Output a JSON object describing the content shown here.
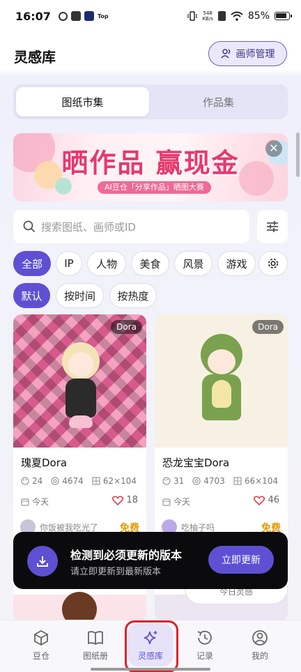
{
  "status_bar": {
    "time": "16:07",
    "top_label": "Top",
    "net_speed_value": "548",
    "net_speed_unit": "KB/s",
    "battery": "85%"
  },
  "header": {
    "title": "灵感库",
    "manage_button": "画师管理"
  },
  "tabs": [
    {
      "label": "图纸市集",
      "active": true
    },
    {
      "label": "作品集",
      "active": false
    }
  ],
  "banner": {
    "title": "晒作品 赢现金",
    "subtitle": "AI豆仓「分享作品」晒图大赛",
    "close_glyph": "✕"
  },
  "search": {
    "placeholder": "搜索图纸、画师或ID"
  },
  "categories": [
    "全部",
    "IP",
    "人物",
    "美食",
    "风景",
    "游戏"
  ],
  "sort_options": [
    "默认",
    "按时间",
    "按热度"
  ],
  "cards": [
    {
      "tag": "Dora",
      "title": "瑰夏Dora",
      "colors_count": "24",
      "views": "4674",
      "size": "62×104",
      "date": "今天",
      "likes": "18",
      "author": "你饭被我吃光了",
      "price": "免费"
    },
    {
      "tag": "Dora",
      "title": "恐龙宝宝Dora",
      "colors_count": "31",
      "views": "4703",
      "size": "66×104",
      "date": "今天",
      "likes": "46",
      "author": "吃柚子吗",
      "price": "免费"
    }
  ],
  "toast": {
    "title": "检测到必须更新的版本",
    "subtitle": "请立即更新到最新版本",
    "button": "立即更新"
  },
  "daily_button": "今日灵感",
  "bottom_nav": [
    {
      "label": "豆仓",
      "icon": "cube-icon",
      "active": false
    },
    {
      "label": "图纸册",
      "icon": "book-icon",
      "active": false
    },
    {
      "label": "灵感库",
      "icon": "sparkle-icon",
      "active": true
    },
    {
      "label": "记录",
      "icon": "history-icon",
      "active": false
    },
    {
      "label": "我的",
      "icon": "user-icon",
      "active": false
    }
  ],
  "colors": {
    "accent": "#5f50d3",
    "price": "#e39b00",
    "like": "#e0404a",
    "banner_title": "#e8386d"
  }
}
